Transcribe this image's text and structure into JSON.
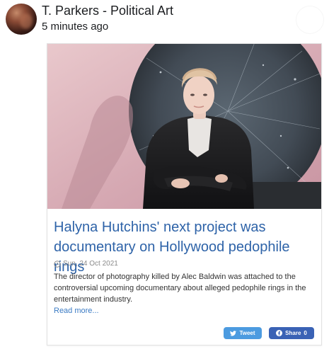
{
  "post": {
    "author": "T. Parkers - Political Art",
    "time": "5 minutes ago"
  },
  "article": {
    "headline": "Halyna Hutchins' next project was documentary on Hollywood pedophile rings",
    "date": "Sun, 24 Oct 2021",
    "excerpt": "The director of photography killed by Alec Baldwin was attached to the controversial upcoming documentary about alleged pedophile rings in the entertainment industry.",
    "read_more": "Read more..."
  },
  "share": {
    "tweet_label": "Tweet",
    "facebook_label": "Share",
    "facebook_count": "0"
  },
  "colors": {
    "headline": "#2e63a8",
    "link": "#3b7bc4",
    "tweet": "#4c9be0",
    "facebook": "#3a62b5"
  },
  "icons": [
    "avatar",
    "clock-icon",
    "twitter-bird-icon",
    "facebook-icon"
  ]
}
